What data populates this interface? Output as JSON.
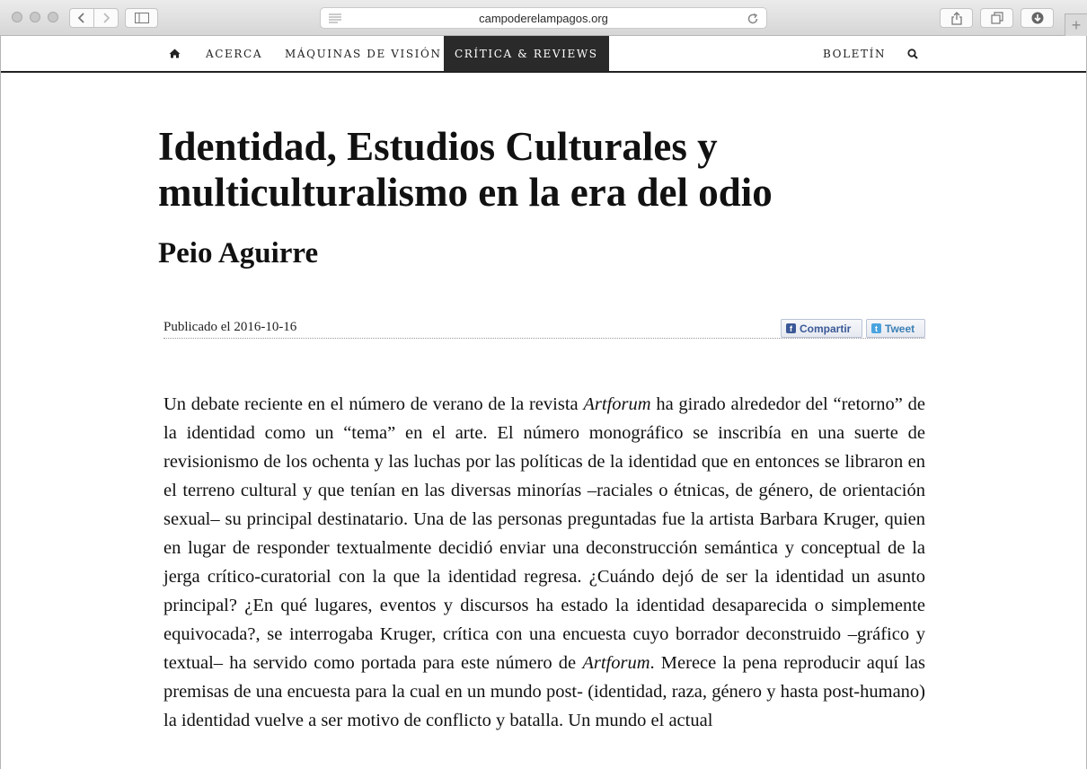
{
  "browser": {
    "url": "campoderelampagos.org"
  },
  "nav": {
    "items": [
      {
        "label": "ACERCA"
      },
      {
        "label": "MÁQUINAS DE VISIÓN"
      },
      {
        "label": "CRÍTICA & REVIEWS"
      },
      {
        "label": "BOLETÍN"
      }
    ]
  },
  "article": {
    "title": "Identidad, Estudios Culturales y multiculturalismo en la era del odio",
    "author": "Peio Aguirre",
    "published": "Publicado el 2016-10-16",
    "share_facebook": "Compartir",
    "share_twitter": "Tweet",
    "body": [
      {
        "text": "Un debate reciente en el número de verano de la revista "
      },
      {
        "text": "Artforum",
        "italic": true
      },
      {
        "text": " ha girado alrededor del “retorno” de la identidad como un “tema” en el arte. El número monográfico se inscribía en una suerte de revisionismo de los ochenta y las luchas por las políticas de la identidad que en entonces se libraron en el terreno cultural y que tenían en las diversas minorías –raciales o étnicas, de género, de orientación sexual– su principal destinatario. Una de las personas preguntadas fue la artista Barbara Kruger, quien en lugar de responder textualmente decidió enviar una deconstrucción semántica y conceptual de la jerga crítico-curatorial con la que la identidad regresa. ¿Cuándo dejó de ser la identidad un asunto principal? ¿En qué lugares, eventos y discursos ha estado la identidad desaparecida o simplemente equivocada?, se interrogaba Kruger, crítica con una encuesta cuyo borrador deconstruido –gráfico y textual– ha servido como portada para este número de "
      },
      {
        "text": "Artforum",
        "italic": true
      },
      {
        "text": ". Merece la pena reproducir aquí las premisas de una encuesta para la cual en un mundo post- (identidad, raza, género y hasta post-humano) la identidad vuelve a ser motivo de conflicto y batalla. Un mundo el actual"
      }
    ]
  }
}
